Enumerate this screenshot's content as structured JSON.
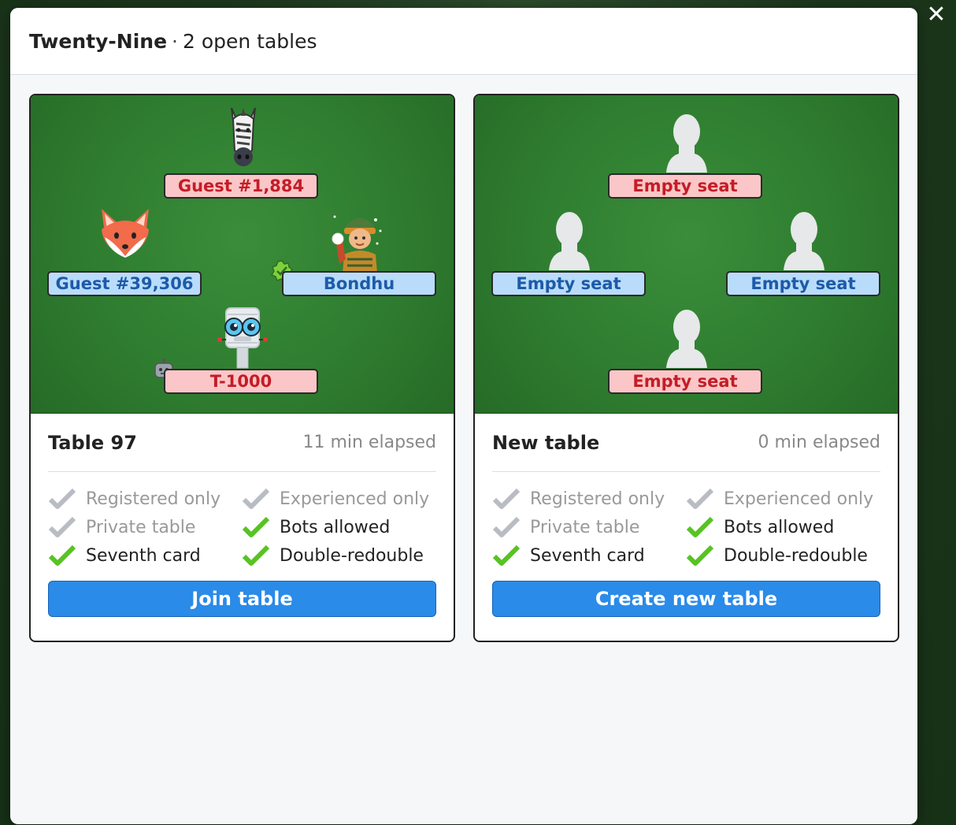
{
  "header": {
    "game_name": "Twenty-Nine",
    "separator": "·",
    "open_tables": "2 open tables"
  },
  "close_symbol": "✕",
  "cards": [
    {
      "seats": {
        "top": {
          "name": "Guest #1,884",
          "avatar": "zebra-icon"
        },
        "left": {
          "name": "Guest #39,306",
          "avatar": "fox-icon"
        },
        "right": {
          "name": "Bondhu",
          "avatar": "snowball-person-icon",
          "badge": "verified-badge-icon"
        },
        "bottom": {
          "name": "T-1000",
          "avatar": "robot-icon",
          "badge": "bot-badge-icon"
        }
      },
      "title": "Table 97",
      "elapsed": "11 min elapsed",
      "options": [
        {
          "label": "Registered only",
          "enabled": false
        },
        {
          "label": "Experienced only",
          "enabled": false
        },
        {
          "label": "Private table",
          "enabled": false
        },
        {
          "label": "Bots allowed",
          "enabled": true
        },
        {
          "label": "Seventh card",
          "enabled": true
        },
        {
          "label": "Double-redouble",
          "enabled": true
        }
      ],
      "button": "Join table"
    },
    {
      "seats": {
        "top": {
          "name": "Empty seat",
          "avatar": "empty-seat-icon"
        },
        "left": {
          "name": "Empty seat",
          "avatar": "empty-seat-icon"
        },
        "right": {
          "name": "Empty seat",
          "avatar": "empty-seat-icon"
        },
        "bottom": {
          "name": "Empty seat",
          "avatar": "empty-seat-icon"
        }
      },
      "title": "New table",
      "elapsed": "0 min elapsed",
      "options": [
        {
          "label": "Registered only",
          "enabled": false
        },
        {
          "label": "Experienced only",
          "enabled": false
        },
        {
          "label": "Private table",
          "enabled": false
        },
        {
          "label": "Bots allowed",
          "enabled": true
        },
        {
          "label": "Seventh card",
          "enabled": true
        },
        {
          "label": "Double-redouble",
          "enabled": true
        }
      ],
      "button": "Create new table"
    }
  ],
  "colors": {
    "felt": "#2f7d30",
    "seat_red_bg": "#fbc6c7",
    "seat_red_text": "#c31d27",
    "seat_blue_bg": "#b9dcfb",
    "seat_blue_text": "#1d5aa8",
    "button_blue": "#2a8be8",
    "check_on": "#58c323",
    "check_off": "#b9bdc3"
  }
}
